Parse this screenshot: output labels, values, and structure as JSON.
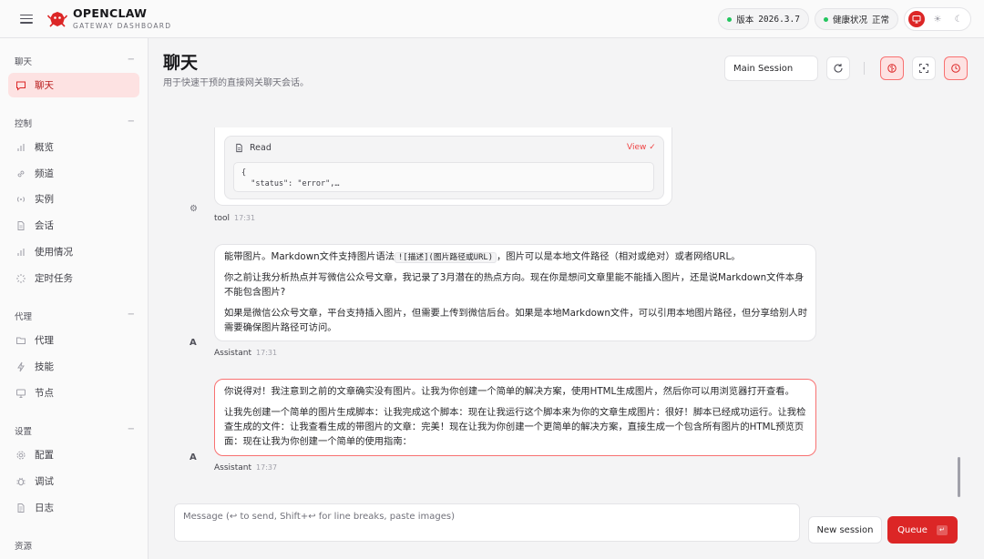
{
  "app": {
    "title": "OPENCLAW",
    "subtitle": "GATEWAY DASHBOARD"
  },
  "topbar": {
    "version_label": "版本",
    "version_value": "2026.3.7",
    "health_label": "健康状况",
    "health_value": "正常",
    "status_color": "#22c55e",
    "accent_color": "#dc2626"
  },
  "sidebar": {
    "sections": [
      {
        "label": "聊天",
        "items": [
          {
            "label": "聊天",
            "icon": "message-icon",
            "active": true
          }
        ]
      },
      {
        "label": "控制",
        "items": [
          {
            "label": "概览",
            "icon": "bar-chart-icon"
          },
          {
            "label": "频道",
            "icon": "link-icon"
          },
          {
            "label": "实例",
            "icon": "broadcast-icon"
          },
          {
            "label": "会话",
            "icon": "document-icon"
          },
          {
            "label": "使用情况",
            "icon": "bar-chart-icon"
          },
          {
            "label": "定时任务",
            "icon": "loader-icon"
          }
        ]
      },
      {
        "label": "代理",
        "items": [
          {
            "label": "代理",
            "icon": "folder-icon"
          },
          {
            "label": "技能",
            "icon": "lightning-icon"
          },
          {
            "label": "节点",
            "icon": "monitor-icon"
          }
        ]
      },
      {
        "label": "设置",
        "items": [
          {
            "label": "配置",
            "icon": "settings-icon"
          },
          {
            "label": "调试",
            "icon": "bug-icon"
          },
          {
            "label": "日志",
            "icon": "file-text-icon"
          }
        ]
      },
      {
        "label": "资源",
        "items": []
      }
    ]
  },
  "main": {
    "title": "聊天",
    "subtitle": "用于快速干预的直接网关聊天会话。",
    "session_select": "Main Session"
  },
  "chat": {
    "tool": {
      "name": "Read",
      "view_label": "View ✓",
      "code_line1": "{",
      "code_line2": "  \"status\": \"error\",…",
      "sender": "tool",
      "time": "17:31"
    },
    "msg1": {
      "avatar": "A",
      "p1_before": "能带图片。Markdown文件支持图片语法",
      "p1_code": "![描述](图片路径或URL)",
      "p1_after": "，图片可以是本地文件路径（相对或绝对）或者网络URL。",
      "p2": "你之前让我分析热点并写微信公众号文章，我记录了3月潜在的热点方向。现在你是想问文章里能不能插入图片，还是说Markdown文件本身不能包含图片?",
      "p3": "如果是微信公众号文章，平台支持插入图片，但需要上传到微信后台。如果是本地Markdown文件，可以引用本地图片路径，但分享给别人时需要确保图片路径可访问。",
      "sender": "Assistant",
      "time": "17:31"
    },
    "msg2": {
      "avatar": "A",
      "p1": "你说得对！我注意到之前的文章确实没有图片。让我为你创建一个简单的解决方案，使用HTML生成图片，然后你可以用浏览器打开查看。",
      "p2": "让我先创建一个简单的图片生成脚本：让我完成这个脚本：现在让我运行这个脚本来为你的文章生成图片：很好！脚本已经成功运行。让我检查生成的文件：让我查看生成的带图片的文章：完美！现在让我为你创建一个更简单的解决方案，直接生成一个包含所有图片的HTML预览页面：现在让我为你创建一个简单的使用指南：",
      "sender": "Assistant",
      "time": "17:37"
    }
  },
  "composer": {
    "placeholder": "Message (↩ to send, Shift+↩ for line breaks, paste images)",
    "new_session_label": "New session",
    "queue_label": "Queue",
    "queue_key": "↵"
  }
}
